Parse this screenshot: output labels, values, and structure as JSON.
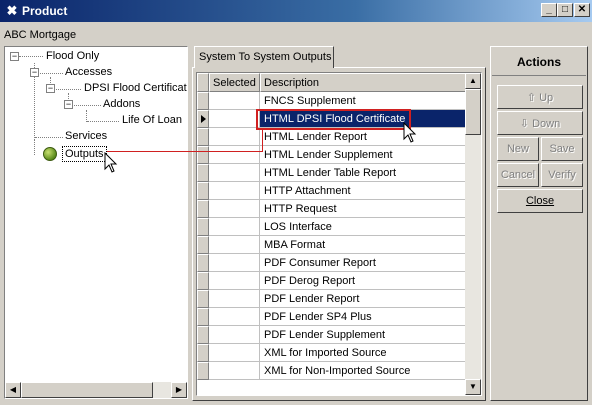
{
  "window": {
    "title": "Product",
    "minimize_glyph": "_",
    "maximize_glyph": "□",
    "close_glyph": "✕",
    "app_icon_glyph": "✖"
  },
  "company_label": "ABC Mortgage",
  "tree": {
    "nodes": [
      {
        "label": "Flood Only"
      },
      {
        "label": "Accesses"
      },
      {
        "label": "DPSI Flood Certificatio"
      },
      {
        "label": "Addons"
      },
      {
        "label": "Life Of Loan"
      },
      {
        "label": "Services"
      },
      {
        "label": "Outputs"
      }
    ],
    "expand_glyph": "−"
  },
  "tab": {
    "label": "System To System Outputs"
  },
  "grid": {
    "columns": [
      "Selected",
      "Description"
    ],
    "rows": [
      "FNCS Supplement",
      "HTML DPSI Flood Certificate",
      "HTML Lender Report",
      "HTML Lender Supplement",
      "HTML Lender Table Report",
      "HTTP Attachment",
      "HTTP Request",
      "LOS Interface",
      "MBA Format",
      "PDF Consumer Report",
      "PDF Derog Report",
      "PDF Lender Report",
      "PDF Lender SP4 Plus",
      "PDF Lender Supplement",
      "XML for Imported Source",
      "XML for Non-Imported Source"
    ],
    "selected_row_index": 1
  },
  "actions": {
    "title": "Actions",
    "up": "Up",
    "down": "Down",
    "new": "New",
    "save": "Save",
    "cancel": "Cancel",
    "verify": "Verify",
    "close": "Close"
  },
  "colors": {
    "selection": "#0a246a",
    "highlight": "#d02020",
    "face": "#d4d0c8"
  }
}
